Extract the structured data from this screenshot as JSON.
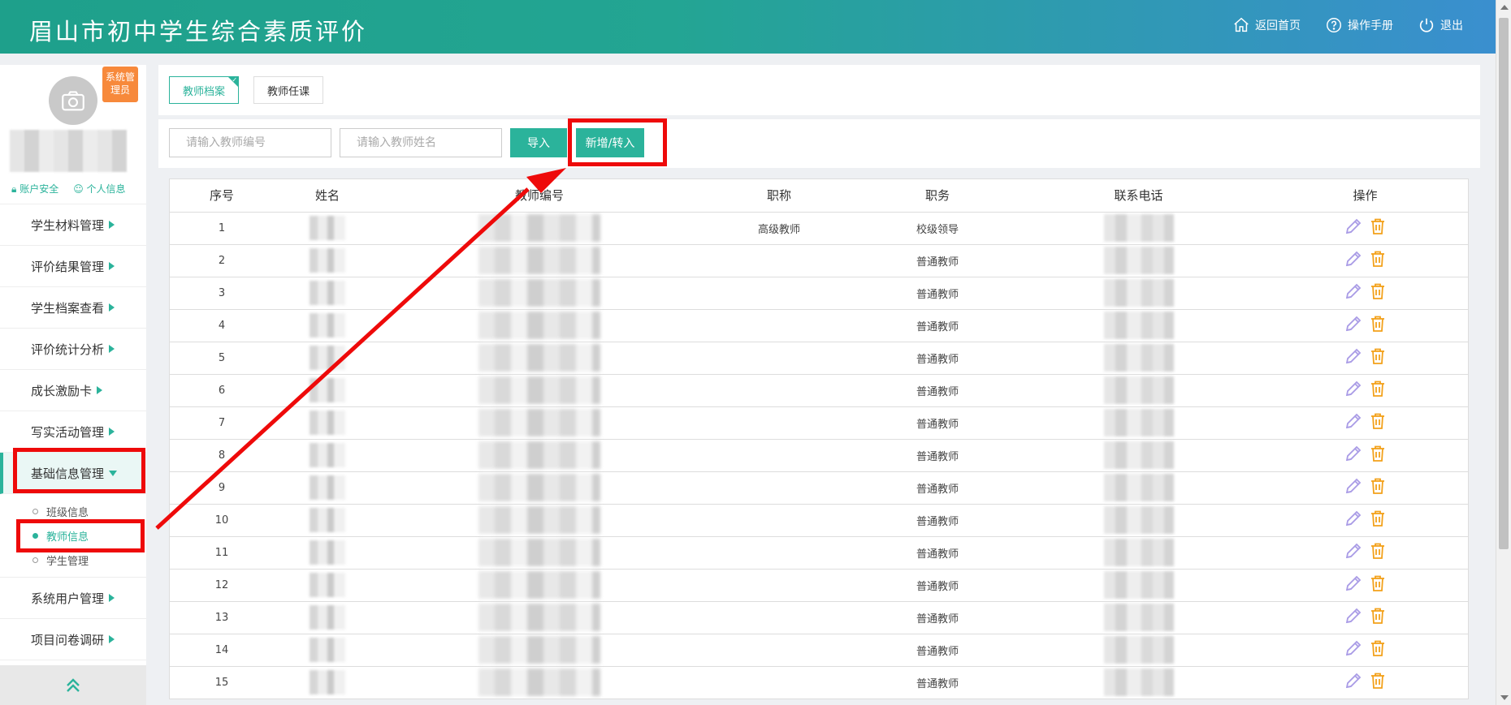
{
  "header": {
    "title": "眉山市初中学生综合素质评价",
    "nav": {
      "home_label": "返回首页",
      "manual_label": "操作手册",
      "logout_label": "退出"
    }
  },
  "sidebar": {
    "role_badge": "系统管理员",
    "links": {
      "account_security": "账户安全",
      "personal_info": "个人信息"
    },
    "menu": [
      {
        "label": "学生材料管理"
      },
      {
        "label": "评价结果管理"
      },
      {
        "label": "学生档案查看"
      },
      {
        "label": "评价统计分析"
      },
      {
        "label": "成长激励卡"
      },
      {
        "label": "写实活动管理"
      },
      {
        "label": "基础信息管理"
      },
      {
        "label": "系统用户管理"
      },
      {
        "label": "项目问卷调研"
      }
    ],
    "submenu": [
      {
        "label": "班级信息"
      },
      {
        "label": "教师信息"
      },
      {
        "label": "学生管理"
      }
    ]
  },
  "tabs": [
    {
      "label": "教师档案"
    },
    {
      "label": "教师任课"
    }
  ],
  "search": {
    "teacher_id_placeholder": "请输入教师编号",
    "teacher_name_placeholder": "请输入教师姓名",
    "import_label": "导入",
    "add_label": "新增/转入"
  },
  "table": {
    "headers": {
      "index": "序号",
      "name": "姓名",
      "teacher_id": "教师编号",
      "title": "职称",
      "position": "职务",
      "phone": "联系电话",
      "actions": "操作"
    },
    "rows": [
      {
        "index": "1",
        "title": "高级教师",
        "position": "校级领导"
      },
      {
        "index": "2",
        "title": "",
        "position": "普通教师"
      },
      {
        "index": "3",
        "title": "",
        "position": "普通教师"
      },
      {
        "index": "4",
        "title": "",
        "position": "普通教师"
      },
      {
        "index": "5",
        "title": "",
        "position": "普通教师"
      },
      {
        "index": "6",
        "title": "",
        "position": "普通教师"
      },
      {
        "index": "7",
        "title": "",
        "position": "普通教师"
      },
      {
        "index": "8",
        "title": "",
        "position": "普通教师"
      },
      {
        "index": "9",
        "title": "",
        "position": "普通教师"
      },
      {
        "index": "10",
        "title": "",
        "position": "普通教师"
      },
      {
        "index": "11",
        "title": "",
        "position": "普通教师"
      },
      {
        "index": "12",
        "title": "",
        "position": "普通教师"
      },
      {
        "index": "13",
        "title": "",
        "position": "普通教师"
      },
      {
        "index": "14",
        "title": "",
        "position": "普通教师"
      },
      {
        "index": "15",
        "title": "",
        "position": "普通教师"
      }
    ]
  },
  "colors": {
    "accent": "#2bb39b",
    "badge": "#f7893b",
    "annotation": "#ee0a0a",
    "edit_icon": "#a99be6",
    "delete_icon": "#f3a11a"
  }
}
